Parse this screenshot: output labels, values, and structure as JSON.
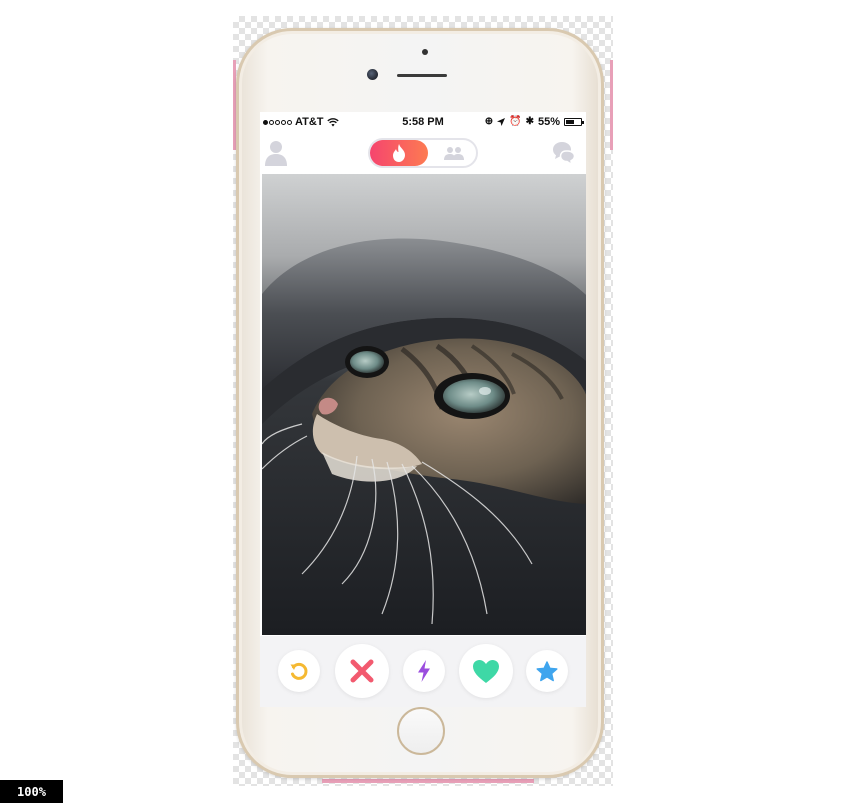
{
  "status_bar": {
    "carrier": "AT&T",
    "signal_bars_filled": 1,
    "signal_bars_total": 5,
    "time": "5:58 PM",
    "battery_percent_label": "55%",
    "battery_level": 0.55
  },
  "nav": {
    "profile_icon": "profile-icon",
    "mode_active_icon": "flame-icon",
    "mode_inactive_icon": "group-icon",
    "chat_icon": "chat-bubbles-icon"
  },
  "card": {
    "image_subject": "cat",
    "image_icon": "cat-photo"
  },
  "actions": [
    {
      "name": "rewind",
      "icon": "rewind-icon",
      "color": "#f5b932"
    },
    {
      "name": "nope",
      "icon": "close-icon",
      "color": "#f25a6f"
    },
    {
      "name": "boost",
      "icon": "lightning-icon",
      "color": "#9b4dde"
    },
    {
      "name": "like",
      "icon": "heart-icon",
      "color": "#3ed8a6"
    },
    {
      "name": "super-like",
      "icon": "star-icon",
      "color": "#3fa5ee"
    }
  ],
  "colors": {
    "brand_gradient_start": "#f5456e",
    "brand_gradient_end": "#fd7b52",
    "inactive_icon": "#d4d4dc"
  },
  "zoom": "100%"
}
